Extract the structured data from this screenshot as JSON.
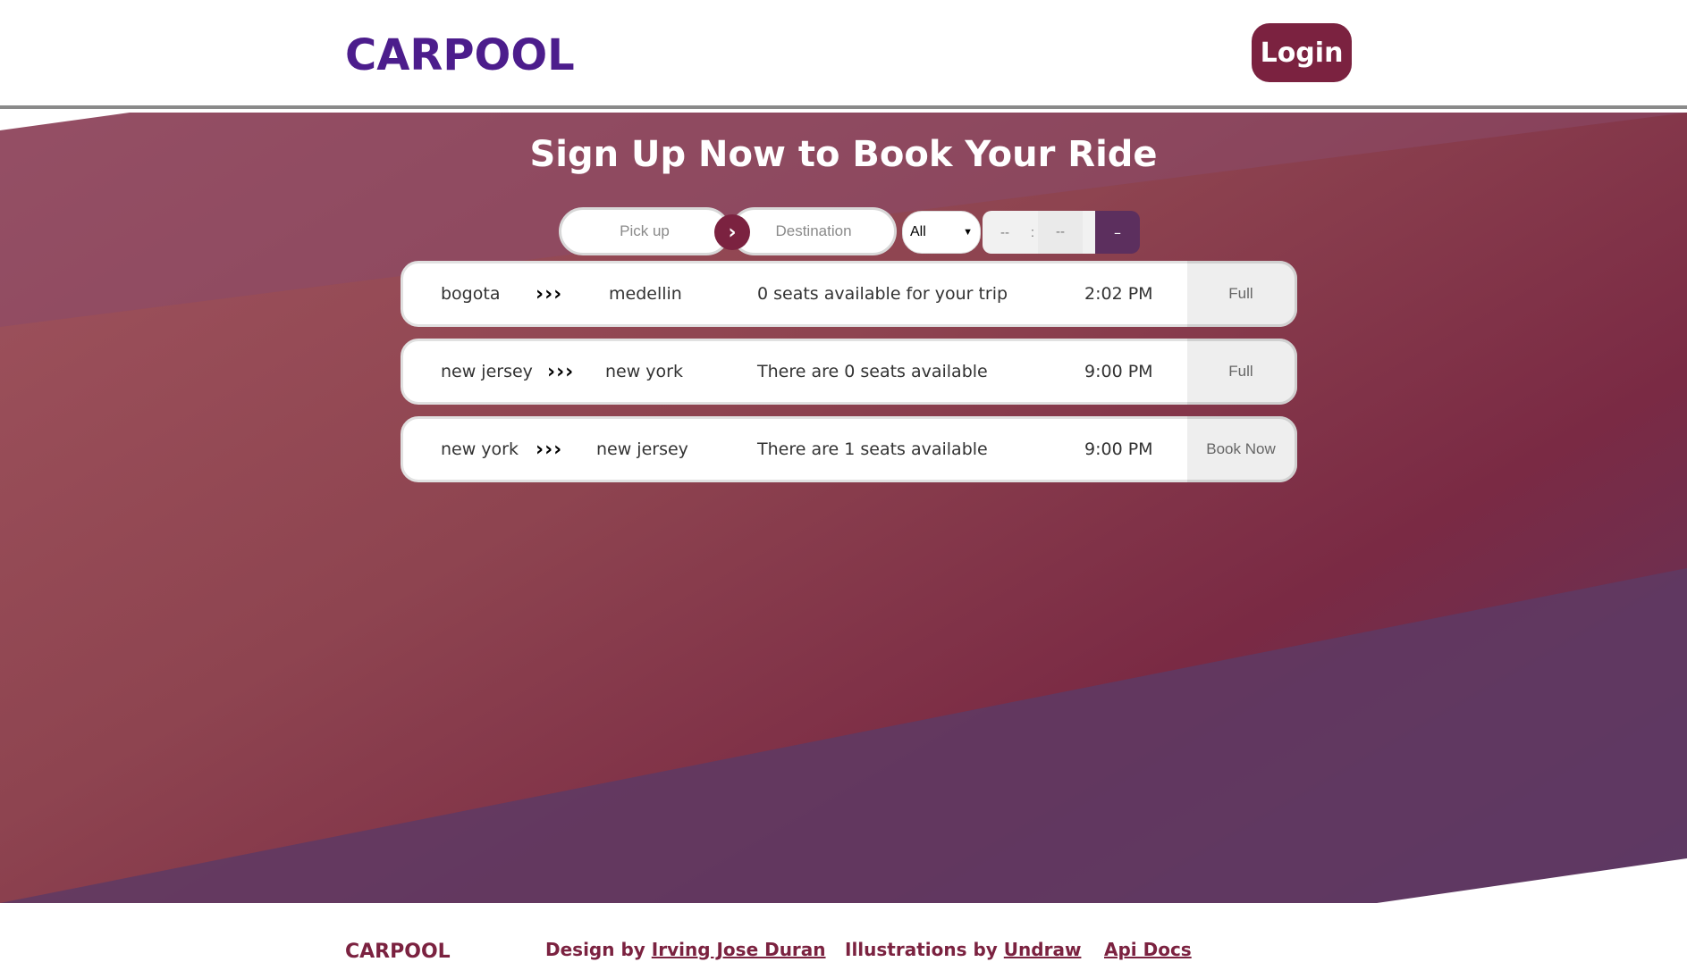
{
  "header": {
    "logo": "CARPOOL",
    "login_label": "Login"
  },
  "hero": {
    "title": "Sign Up Now to Book Your Ride"
  },
  "search": {
    "pickup_placeholder": "Pick up",
    "destination_placeholder": "Destination",
    "filter_selected": "All",
    "hour": "--",
    "minute": "--",
    "clear_label": "–"
  },
  "rides": [
    {
      "from": "bogota",
      "arrows": "›››",
      "to": "medellin",
      "seats": "0 seats available for your trip",
      "time": "2:02 PM",
      "action": "Full"
    },
    {
      "from": "new jersey",
      "arrows": "›››",
      "to": "new york",
      "seats": "There are 0 seats available",
      "time": "9:00 PM",
      "action": "Full"
    },
    {
      "from": "new york",
      "arrows": "›››",
      "to": "new jersey",
      "seats": "There are 1 seats available",
      "time": "9:00 PM",
      "action": "Book Now"
    }
  ],
  "footer": {
    "logo": "CARPOOL",
    "design_prefix": "Design by ",
    "design_link": "Irving Jose Duran",
    "illustrations_prefix": "Illustrations by ",
    "illustrations_link": "Undraw",
    "api_link": "Api Docs"
  },
  "colors": {
    "brand": "#4c1d8c",
    "accent": "#7b2240",
    "clear_button": "#5c2f5e"
  },
  "icons": {
    "route_arrow": "chevron-right-icon"
  }
}
